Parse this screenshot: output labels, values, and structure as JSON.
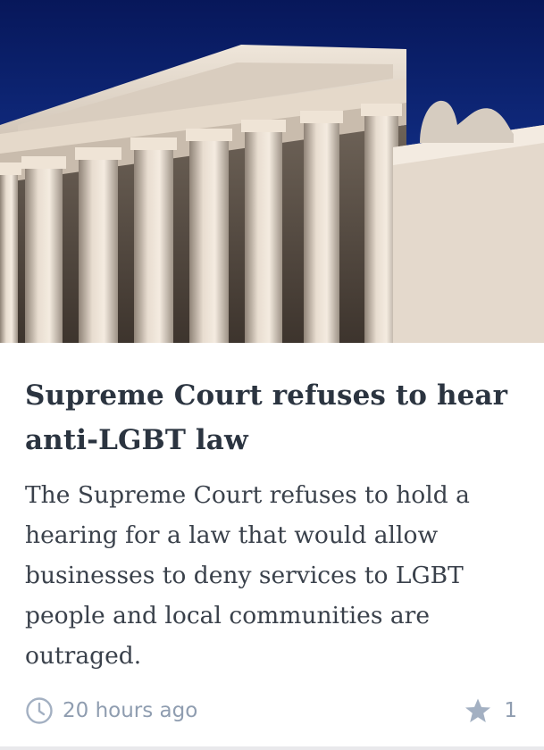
{
  "article": {
    "image_alt": "Supreme Court building facade with columns against a blue sky",
    "headline": "Supreme Court refuses to hear anti-LGBT law",
    "summary": "The Supreme Court refuses to hold a hearing for a law that would allow businesses to deny services to LGBT people and local communities are outraged.",
    "timestamp": "20 hours ago",
    "favorite_count": "1"
  },
  "icons": {
    "clock": "clock-icon",
    "star": "star-icon"
  },
  "colors": {
    "headline": "#2b3440",
    "body": "#3a414b",
    "meta": "#8f9db0",
    "sky": "#14348f"
  }
}
